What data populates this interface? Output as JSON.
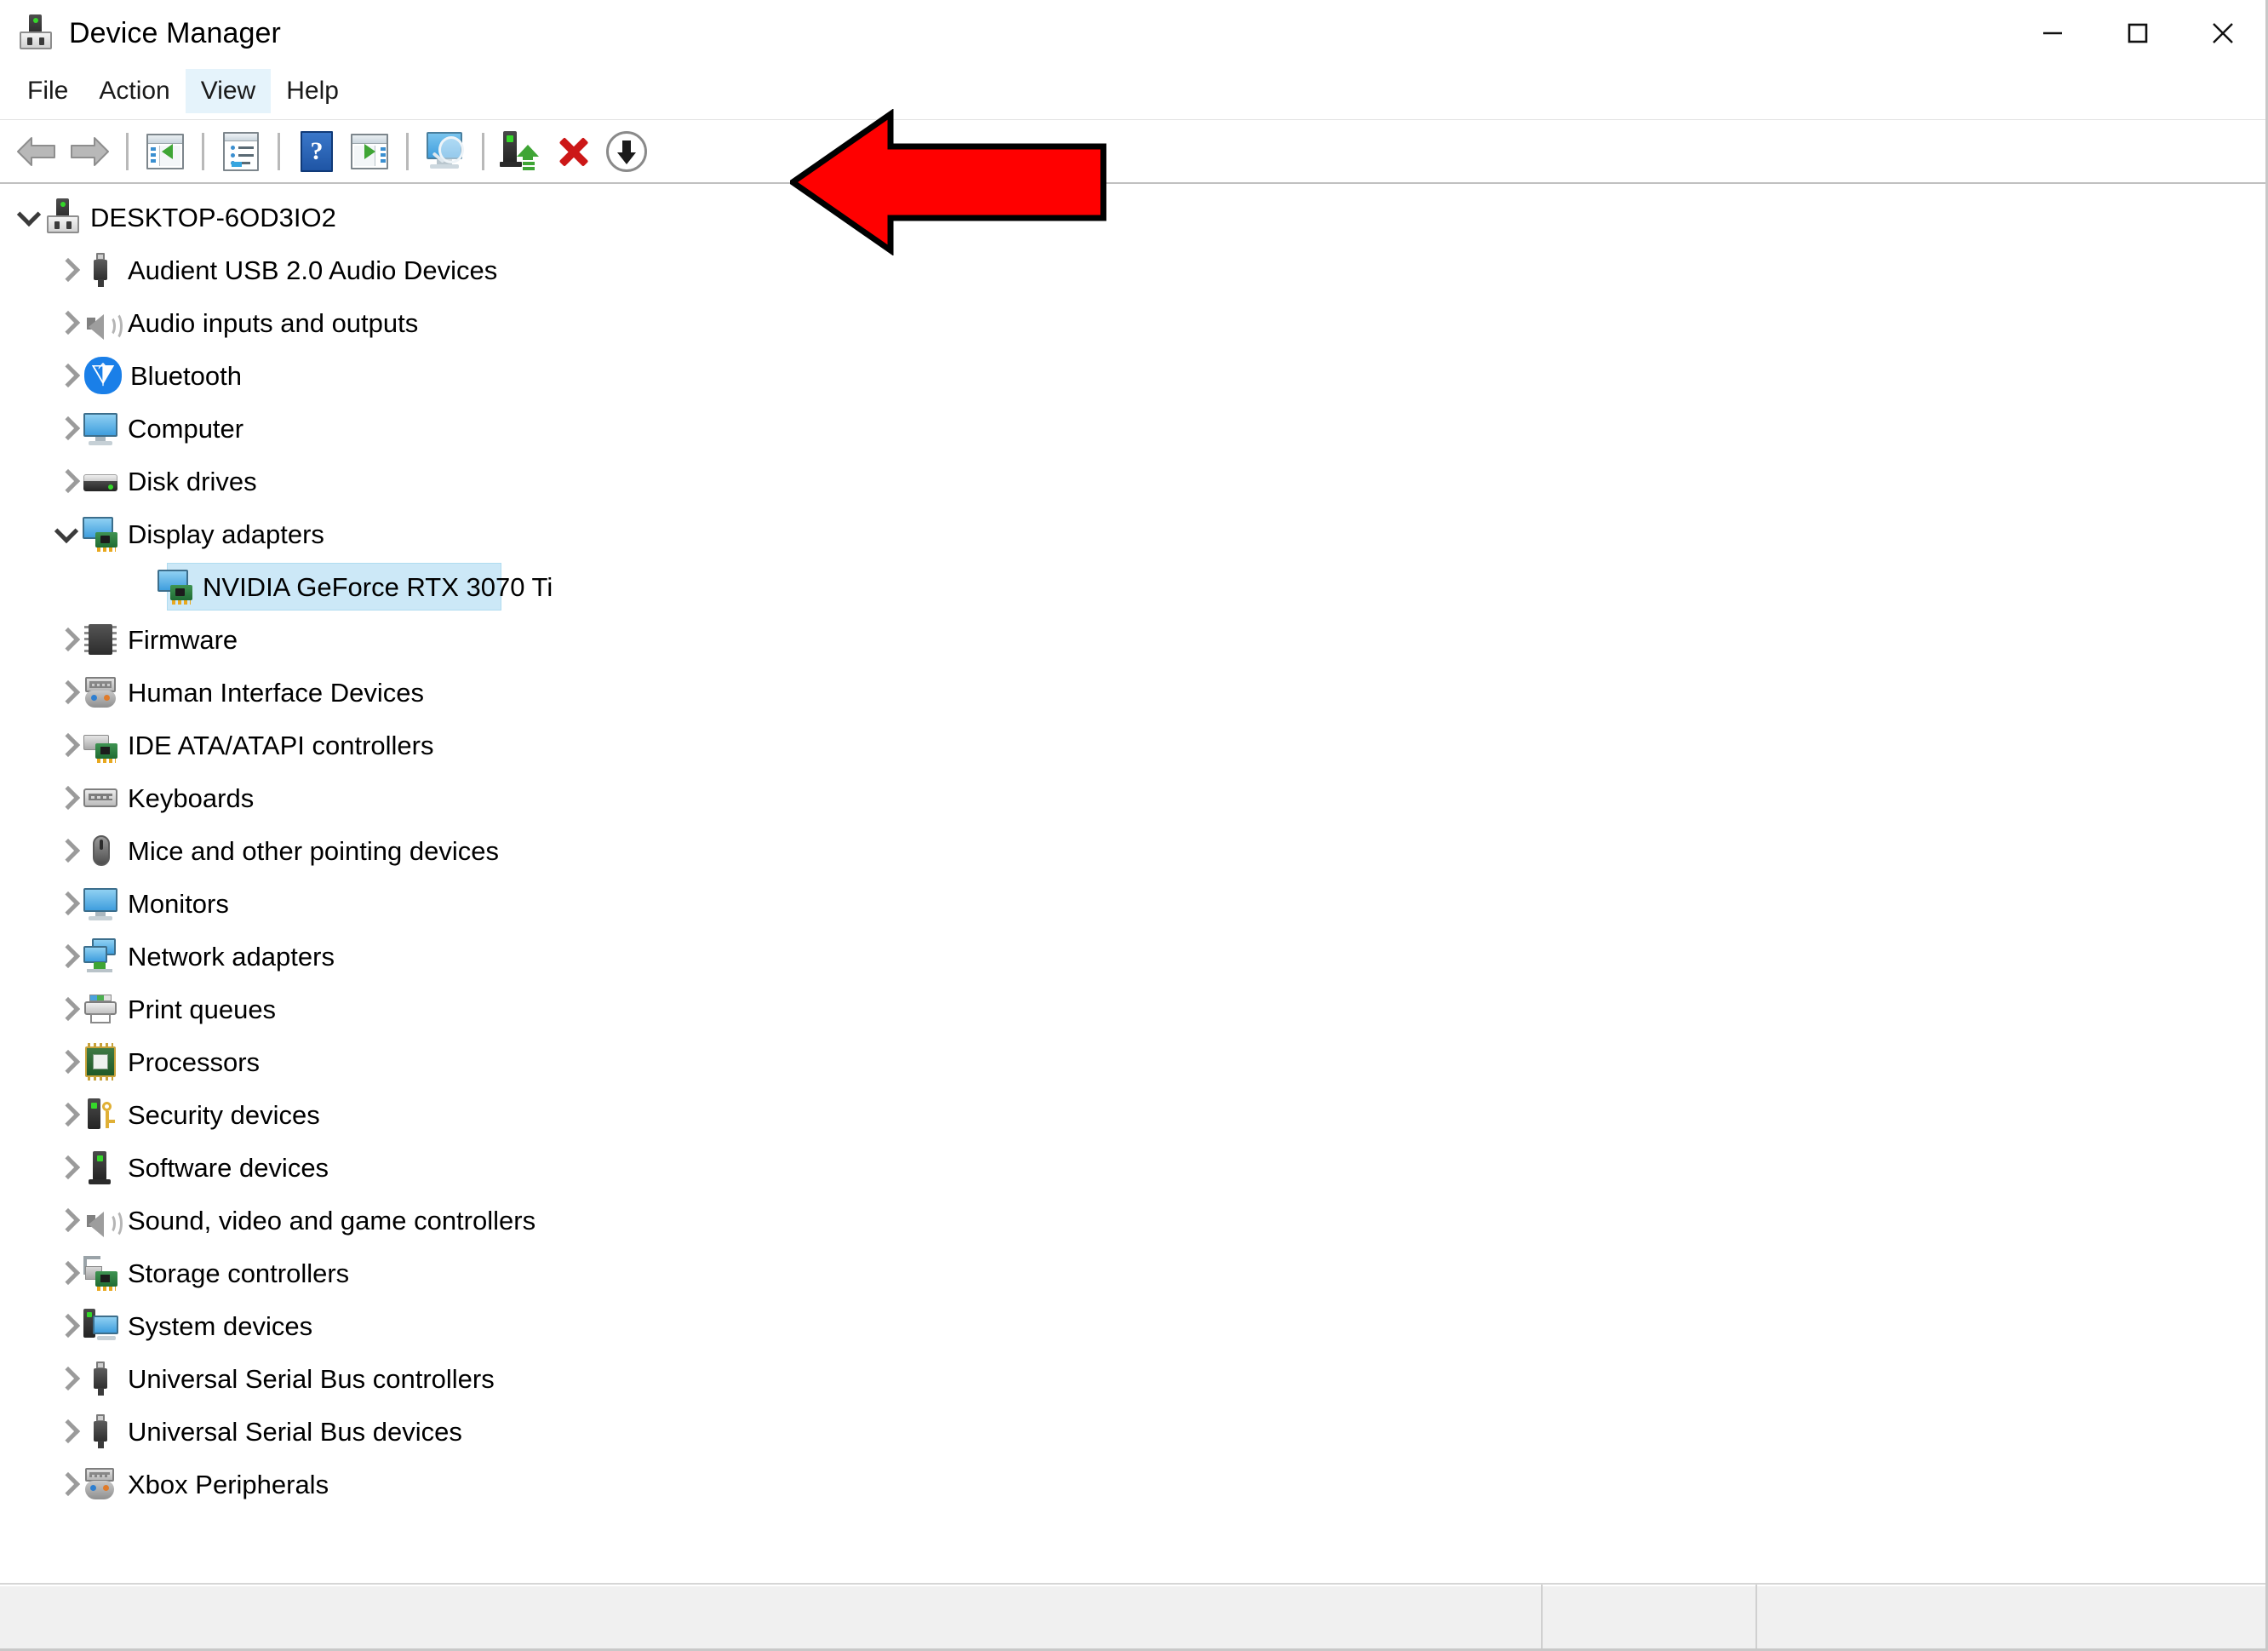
{
  "window": {
    "title": "Device Manager",
    "title_icon": "device-manager-icon",
    "controls": {
      "minimize": "minimize-icon",
      "maximize": "maximize-icon",
      "close": "close-icon"
    }
  },
  "menubar": {
    "items": [
      {
        "label": "File",
        "active": false
      },
      {
        "label": "Action",
        "active": false
      },
      {
        "label": "View",
        "active": true
      },
      {
        "label": "Help",
        "active": false
      }
    ]
  },
  "toolbar": {
    "buttons": [
      {
        "name": "back-button",
        "icon": "back-arrow-icon",
        "tooltip": "Back",
        "disabled": true
      },
      {
        "name": "forward-button",
        "icon": "forward-arrow-icon",
        "tooltip": "Forward",
        "disabled": true
      },
      {
        "name": "show-hide-console-tree",
        "icon": "console-tree-icon",
        "tooltip": "Show/Hide Console Tree",
        "disabled": false
      },
      {
        "name": "properties-button",
        "icon": "properties-icon",
        "tooltip": "Properties",
        "disabled": false
      },
      {
        "name": "help-button",
        "icon": "help-question-icon",
        "tooltip": "Help",
        "disabled": false
      },
      {
        "name": "show-hide-action-pane",
        "icon": "action-pane-icon",
        "tooltip": "Show/Hide Action Pane",
        "disabled": false
      },
      {
        "name": "scan-hardware-changes-button",
        "icon": "scan-monitor-magnifier-icon",
        "tooltip": "Scan for hardware changes",
        "disabled": false
      },
      {
        "name": "update-driver-button",
        "icon": "update-driver-icon",
        "tooltip": "Update driver",
        "disabled": false
      },
      {
        "name": "uninstall-device-button",
        "icon": "red-x-icon",
        "tooltip": "Uninstall device",
        "disabled": false
      },
      {
        "name": "disable-device-button",
        "icon": "disable-down-arrow-icon",
        "tooltip": "Disable device",
        "disabled": false
      }
    ]
  },
  "annotation": {
    "type": "arrow",
    "direction": "left",
    "fill_color": "#FF0000",
    "stroke_color": "#000000",
    "points_at": "disable-device-button"
  },
  "tree": {
    "root": {
      "label": "DESKTOP-6OD3IO2",
      "icon": "device-manager-icon",
      "expanded": true,
      "depth": 0,
      "selected": false
    },
    "nodes": [
      {
        "label": "Audient USB 2.0 Audio Devices",
        "icon": "usb-icon",
        "expanded": false,
        "depth": 1,
        "selected": false
      },
      {
        "label": "Audio inputs and outputs",
        "icon": "speaker-icon",
        "expanded": false,
        "depth": 1,
        "selected": false
      },
      {
        "label": "Bluetooth",
        "icon": "bluetooth-icon",
        "expanded": false,
        "depth": 1,
        "selected": false
      },
      {
        "label": "Computer",
        "icon": "monitor-icon",
        "expanded": false,
        "depth": 1,
        "selected": false
      },
      {
        "label": "Disk drives",
        "icon": "disk-drive-icon",
        "expanded": false,
        "depth": 1,
        "selected": false
      },
      {
        "label": "Display adapters",
        "icon": "display-adapter-icon",
        "expanded": true,
        "depth": 1,
        "selected": false
      },
      {
        "label": "NVIDIA GeForce RTX 3070 Ti",
        "icon": "display-adapter-icon",
        "expanded": null,
        "depth": 2,
        "selected": true
      },
      {
        "label": "Firmware",
        "icon": "firmware-chip-icon",
        "expanded": false,
        "depth": 1,
        "selected": false
      },
      {
        "label": "Human Interface Devices",
        "icon": "hid-icon",
        "expanded": false,
        "depth": 1,
        "selected": false
      },
      {
        "label": "IDE ATA/ATAPI controllers",
        "icon": "ide-controller-icon",
        "expanded": false,
        "depth": 1,
        "selected": false
      },
      {
        "label": "Keyboards",
        "icon": "keyboard-icon",
        "expanded": false,
        "depth": 1,
        "selected": false
      },
      {
        "label": "Mice and other pointing devices",
        "icon": "mouse-icon",
        "expanded": false,
        "depth": 1,
        "selected": false
      },
      {
        "label": "Monitors",
        "icon": "monitor-icon",
        "expanded": false,
        "depth": 1,
        "selected": false
      },
      {
        "label": "Network adapters",
        "icon": "network-adapter-icon",
        "expanded": false,
        "depth": 1,
        "selected": false
      },
      {
        "label": "Print queues",
        "icon": "printer-icon",
        "expanded": false,
        "depth": 1,
        "selected": false
      },
      {
        "label": "Processors",
        "icon": "cpu-icon",
        "expanded": false,
        "depth": 1,
        "selected": false
      },
      {
        "label": "Security devices",
        "icon": "security-key-icon",
        "expanded": false,
        "depth": 1,
        "selected": false
      },
      {
        "label": "Software devices",
        "icon": "software-device-icon",
        "expanded": false,
        "depth": 1,
        "selected": false
      },
      {
        "label": "Sound, video and game controllers",
        "icon": "speaker-icon",
        "expanded": false,
        "depth": 1,
        "selected": false
      },
      {
        "label": "Storage controllers",
        "icon": "storage-controller-icon",
        "expanded": false,
        "depth": 1,
        "selected": false
      },
      {
        "label": "System devices",
        "icon": "system-device-icon",
        "expanded": false,
        "depth": 1,
        "selected": false
      },
      {
        "label": "Universal Serial Bus controllers",
        "icon": "usb-icon",
        "expanded": false,
        "depth": 1,
        "selected": false
      },
      {
        "label": "Universal Serial Bus devices",
        "icon": "usb-icon",
        "expanded": false,
        "depth": 1,
        "selected": false
      },
      {
        "label": "Xbox Peripherals",
        "icon": "hid-icon",
        "expanded": false,
        "depth": 1,
        "selected": false
      }
    ]
  },
  "statusbar": {
    "panes": [
      "",
      "",
      ""
    ]
  },
  "colors": {
    "selection": "#cce8f7",
    "menu_highlight": "#e5f3fb",
    "annotation_red": "#FF0000",
    "window_bg": "#ffffff",
    "statusbar_bg": "#f0f0f0"
  }
}
